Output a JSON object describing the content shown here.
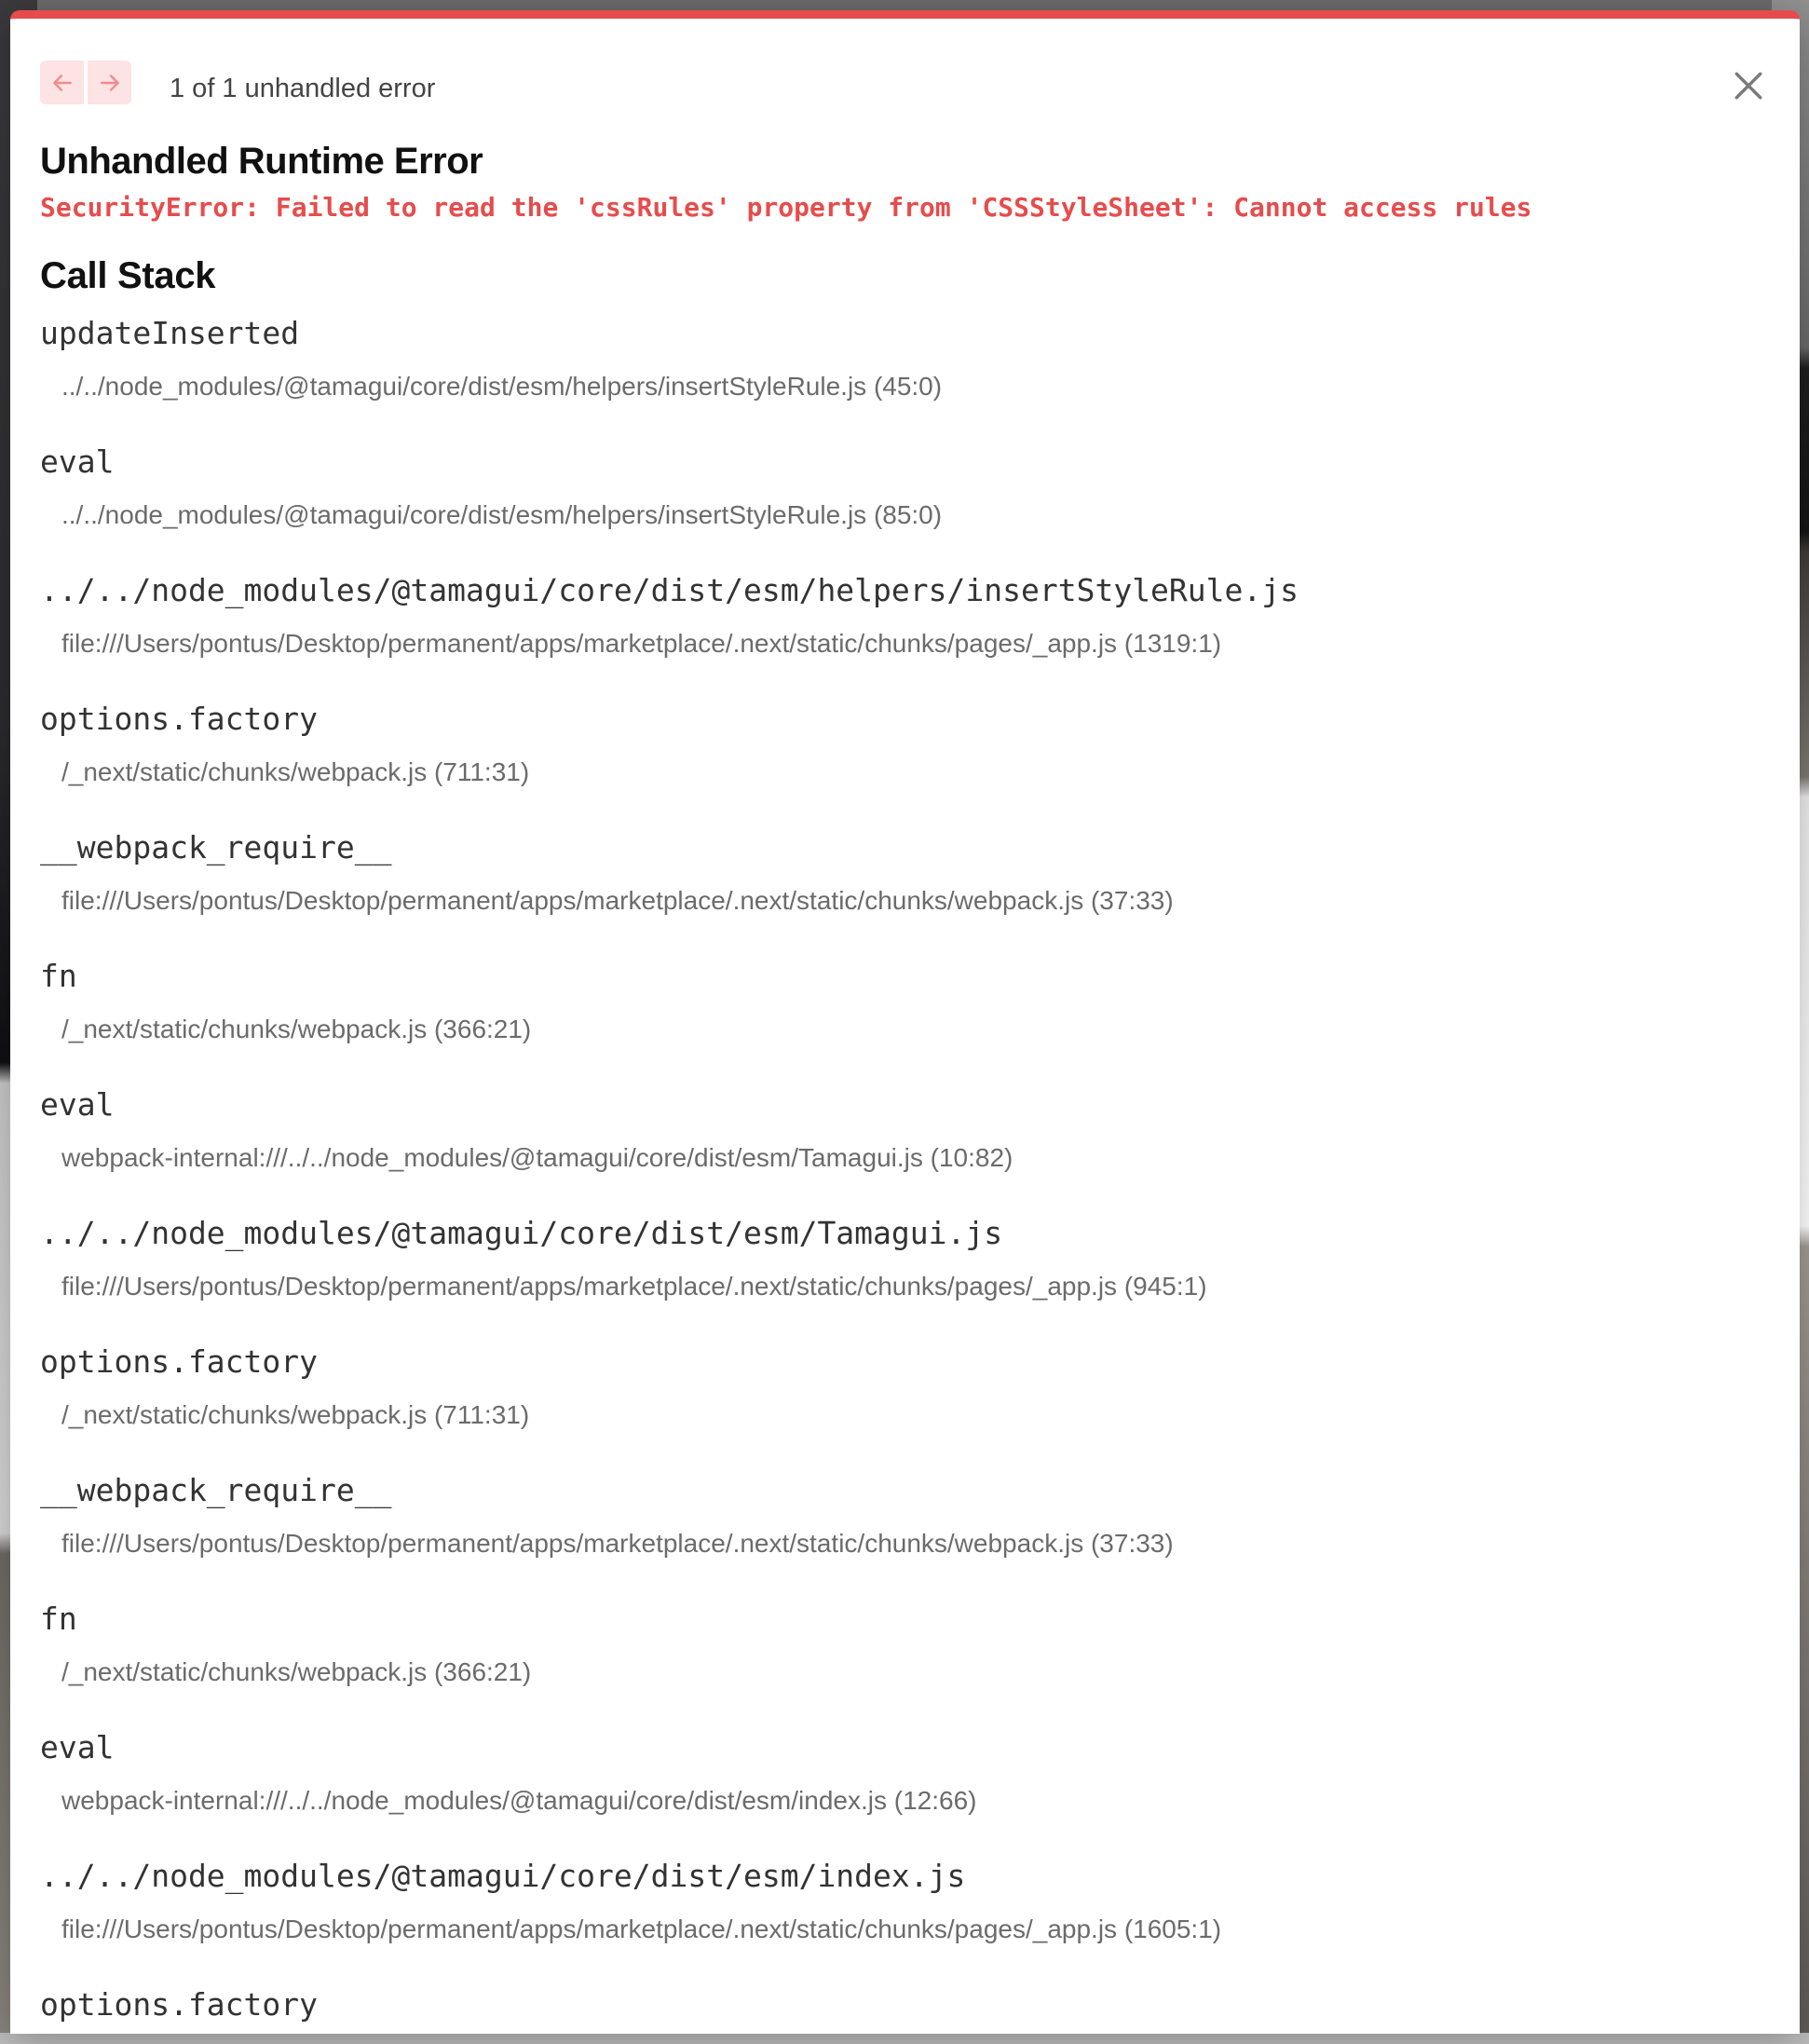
{
  "colors": {
    "accent": "#e74c4c",
    "nav_bg": "#fde3e3",
    "nav_arrow": "#f08c8c"
  },
  "header": {
    "prev_icon": "arrow-left-icon",
    "next_icon": "arrow-right-icon",
    "counter": "1 of 1 unhandled error",
    "close_icon": "close-icon"
  },
  "error": {
    "title": "Unhandled Runtime Error",
    "message": "SecurityError: Failed to read the 'cssRules' property from 'CSSStyleSheet': Cannot access rules"
  },
  "call_stack": {
    "heading": "Call Stack",
    "frames": [
      {
        "fn": "updateInserted",
        "loc": "../../node_modules/@tamagui/core/dist/esm/helpers/insertStyleRule.js (45:0)"
      },
      {
        "fn": "eval",
        "loc": "../../node_modules/@tamagui/core/dist/esm/helpers/insertStyleRule.js (85:0)"
      },
      {
        "fn": "../../node_modules/@tamagui/core/dist/esm/helpers/insertStyleRule.js",
        "loc": "file:///Users/pontus/Desktop/permanent/apps/marketplace/.next/static/chunks/pages/_app.js (1319:1)"
      },
      {
        "fn": "options.factory",
        "loc": "/_next/static/chunks/webpack.js (711:31)"
      },
      {
        "fn": "__webpack_require__",
        "loc": "file:///Users/pontus/Desktop/permanent/apps/marketplace/.next/static/chunks/webpack.js (37:33)"
      },
      {
        "fn": "fn",
        "loc": "/_next/static/chunks/webpack.js (366:21)"
      },
      {
        "fn": "eval",
        "loc": "webpack-internal:///../../node_modules/@tamagui/core/dist/esm/Tamagui.js (10:82)"
      },
      {
        "fn": "../../node_modules/@tamagui/core/dist/esm/Tamagui.js",
        "loc": "file:///Users/pontus/Desktop/permanent/apps/marketplace/.next/static/chunks/pages/_app.js (945:1)"
      },
      {
        "fn": "options.factory",
        "loc": "/_next/static/chunks/webpack.js (711:31)"
      },
      {
        "fn": "__webpack_require__",
        "loc": "file:///Users/pontus/Desktop/permanent/apps/marketplace/.next/static/chunks/webpack.js (37:33)"
      },
      {
        "fn": "fn",
        "loc": "/_next/static/chunks/webpack.js (366:21)"
      },
      {
        "fn": "eval",
        "loc": "webpack-internal:///../../node_modules/@tamagui/core/dist/esm/index.js (12:66)"
      },
      {
        "fn": "../../node_modules/@tamagui/core/dist/esm/index.js",
        "loc": "file:///Users/pontus/Desktop/permanent/apps/marketplace/.next/static/chunks/pages/_app.js (1605:1)"
      },
      {
        "fn": "options.factory",
        "loc": ""
      }
    ]
  }
}
